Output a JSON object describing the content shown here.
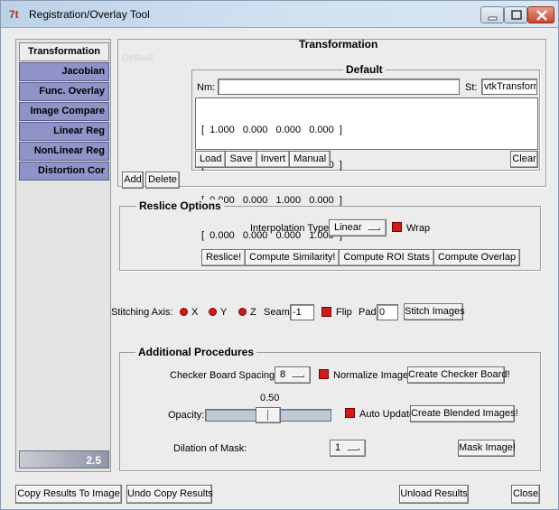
{
  "window": {
    "title": "Registration/Overlay Tool",
    "app_icon": "7t",
    "controls": [
      "minimize-icon",
      "maximize-icon",
      "close-icon"
    ],
    "close_color": "#c7452c"
  },
  "sidebar": {
    "tabs": [
      {
        "label": "Transformation",
        "active": true
      },
      {
        "label": "Jacobian"
      },
      {
        "label": "Func. Overlay"
      },
      {
        "label": "Image Compare"
      },
      {
        "label": "Linear Reg"
      },
      {
        "label": "NonLinear Reg"
      },
      {
        "label": "Distortion Cor"
      }
    ],
    "version": "2.5",
    "tab_color": "#8f93c8"
  },
  "transformation": {
    "title": "Transformation",
    "faded_label": "Default",
    "default_group": {
      "title": "Default",
      "nm_label": "Nm:",
      "nm_value": "",
      "st_label": "St:",
      "st_value": "vtkTransform",
      "matrix_rows": [
        "[  1.000   0.000   0.000   0.000  ]",
        "[  0.000   1.000   0.000   0.000  ]",
        "[  0.000   0.000   1.000   0.000  ]",
        "[  0.000   0.000   0.000   1.000  ]"
      ],
      "buttons": [
        "Load",
        "Save",
        "Invert",
        "Manual"
      ],
      "clear": "Clear"
    },
    "add": "Add",
    "delete": "Delete"
  },
  "reslice": {
    "title": "Reslice Options",
    "interp_label": "Interpolation Type:",
    "interp_value": "Linear",
    "wrap": "Wrap",
    "buttons": [
      "Reslice!",
      "Compute Similarity!",
      "Compute ROI Stats",
      "Compute Overlap"
    ]
  },
  "stitch": {
    "axis_label": "Stitching Axis:",
    "axes": [
      "X",
      "Y",
      "Z"
    ],
    "seam_label": "Seam",
    "seam_value": "-1",
    "flip": "Flip",
    "pad_label": "Pad",
    "pad_value": "0",
    "button": "Stitch Images"
  },
  "additional": {
    "title": "Additional Procedures",
    "checker_label": "Checker Board Spacing:",
    "checker_value": "8",
    "normalize": "Normalize Images",
    "checker_button": "Create Checker Board!",
    "opacity_label": "Opacity:",
    "opacity_value": "0.50",
    "opacity_fraction": 0.5,
    "auto_update": "Auto Update",
    "blend_button": "Create Blended Images!",
    "dilation_label": "Dilation of Mask:",
    "dilation_value": "1",
    "mask_button": "Mask Image!"
  },
  "bottom": {
    "copy": "Copy Results To Image",
    "undo": "Undo Copy Results",
    "unload": "Unload Results",
    "close": "Close"
  },
  "accent_red": "#d11b1b"
}
